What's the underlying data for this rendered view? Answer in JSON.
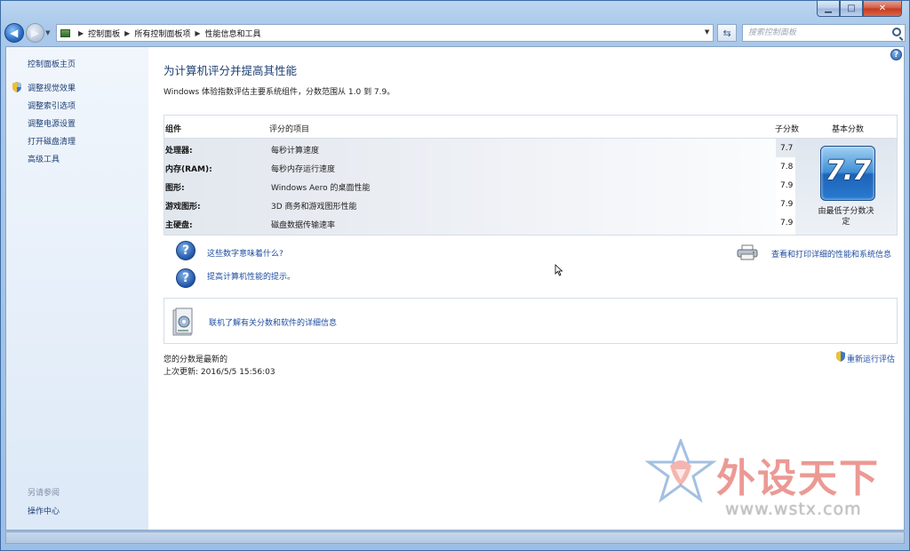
{
  "window": {
    "caption_min": "▁",
    "caption_max": "□",
    "caption_close": "✕"
  },
  "nav": {
    "back_glyph": "◀",
    "forward_glyph": "▶",
    "refresh_glyph": "⇆",
    "breadcrumbs": [
      "控制面板",
      "所有控制面板项",
      "性能信息和工具"
    ],
    "search_placeholder": "搜索控制面板"
  },
  "left_pane": {
    "home": "控制面板主页",
    "tasks": [
      "调整视觉效果",
      "调整索引选项",
      "调整电源设置",
      "打开磁盘清理",
      "高级工具"
    ],
    "see_also_label": "另请参阅",
    "see_also": [
      "操作中心"
    ]
  },
  "main": {
    "help_glyph": "?",
    "title": "为计算机评分并提高其性能",
    "description": "Windows 体验指数评估主要系统组件，分数范围从 1.0 到 7.9。",
    "table": {
      "headers": {
        "component": "组件",
        "item": "评分的项目",
        "subscore": "子分数",
        "basescore": "基本分数"
      },
      "rows": [
        {
          "component": "处理器:",
          "item": "每秒计算速度",
          "subscore": "7.7"
        },
        {
          "component": "内存(RAM):",
          "item": "每秒内存运行速度",
          "subscore": "7.8"
        },
        {
          "component": "图形:",
          "item": "Windows Aero 的桌面性能",
          "subscore": "7.9"
        },
        {
          "component": "游戏图形:",
          "item": "3D 商务和游戏图形性能",
          "subscore": "7.9"
        },
        {
          "component": "主硬盘:",
          "item": "磁盘数据传输速率",
          "subscore": "7.9"
        }
      ],
      "base_score": "7.7",
      "base_caption_1": "由最低子分数决",
      "base_caption_2": "定"
    },
    "links": {
      "what_mean": "这些数字意味着什么?",
      "tips": "提高计算机性能的提示。",
      "print_details": "查看和打印详细的性能和系统信息",
      "online_info": "联机了解有关分数和软件的详细信息",
      "rerun": "重新运行评估"
    },
    "status": {
      "current": "您的分数是最新的",
      "last_update_label": "上次更新: ",
      "last_update_value": "2016/5/5 15:56:03"
    }
  },
  "watermark": {
    "title": "外设天下",
    "url": "www.wstx.com"
  },
  "colors": {
    "link": "#1f4ea1",
    "title": "#1e3f74",
    "accent_blue": "#2a6ec5"
  }
}
